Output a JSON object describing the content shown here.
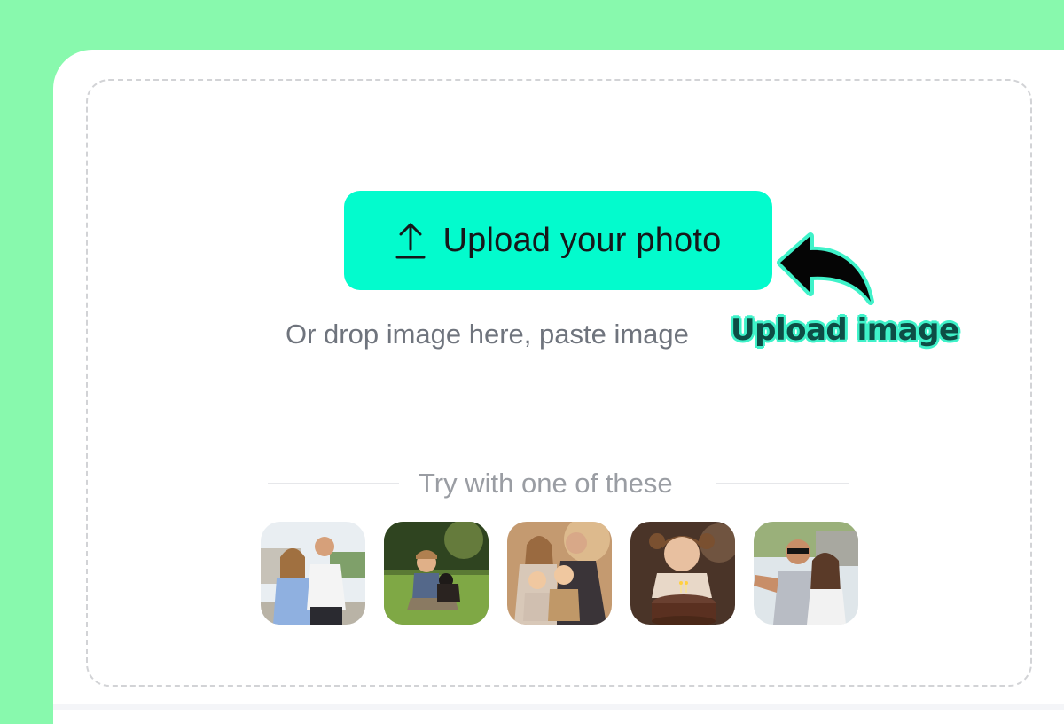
{
  "upload": {
    "button_label": "Upload your photo",
    "icon": "upload-arrow-icon",
    "drop_hint": "Or drop image here, paste image"
  },
  "annotation": {
    "label": "Upload image",
    "icon": "curved-arrow-icon"
  },
  "samples": {
    "heading": "Try with one of these",
    "items": [
      {
        "subject": "couple-outdoors"
      },
      {
        "subject": "boy-with-puppy"
      },
      {
        "subject": "family-portrait"
      },
      {
        "subject": "girl-with-birthday-cake"
      },
      {
        "subject": "couple-selfie"
      }
    ]
  },
  "colors": {
    "page_bg": "#88f9ad",
    "accent": "#03fbcd",
    "annotation_outline": "#3ff2c9"
  }
}
